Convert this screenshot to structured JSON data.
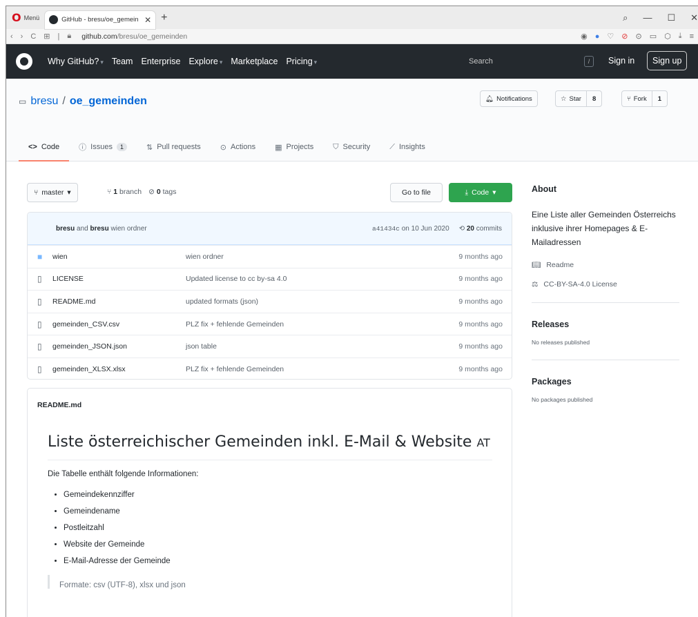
{
  "browser": {
    "menu_label": "Menü",
    "tab_title": "GitHub - bresu/oe_gemein",
    "url_host": "github.com",
    "url_path": "/bresu/oe_gemeinden"
  },
  "github_header": {
    "nav": [
      "Why GitHub?",
      "Team",
      "Enterprise",
      "Explore",
      "Marketplace",
      "Pricing"
    ],
    "search_placeholder": "Search",
    "slash_hint": "/",
    "sign_in": "Sign in",
    "sign_up": "Sign up"
  },
  "repo": {
    "owner": "bresu",
    "separator": "/",
    "name": "oe_gemeinden",
    "notifications_label": "Notifications",
    "star_label": "Star",
    "star_count": "8",
    "fork_label": "Fork",
    "fork_count": "1"
  },
  "tabs": [
    {
      "label": "Code"
    },
    {
      "label": "Issues",
      "badge": "1"
    },
    {
      "label": "Pull requests"
    },
    {
      "label": "Actions"
    },
    {
      "label": "Projects"
    },
    {
      "label": "Security"
    },
    {
      "label": "Insights"
    }
  ],
  "branch": {
    "name": "master",
    "branch_count": "1",
    "branch_label": "branch",
    "tag_count": "0",
    "tag_label": "tags",
    "go_to_file": "Go to file",
    "code_button": "Code"
  },
  "commit": {
    "author": "bresu",
    "and": "and",
    "coauthor": "bresu",
    "message": "wien ordner",
    "sha": "a41434c",
    "date": "on 10 Jun 2020",
    "commits_count": "20",
    "commits_label": "commits"
  },
  "files": [
    {
      "name": "wien",
      "message": "wien ordner",
      "age": "9 months ago",
      "type": "dir"
    },
    {
      "name": "LICENSE",
      "message": "Updated license to cc by-sa 4.0",
      "age": "9 months ago",
      "type": "file"
    },
    {
      "name": "README.md",
      "message": "updated formats (json)",
      "age": "9 months ago",
      "type": "file"
    },
    {
      "name": "gemeinden_CSV.csv",
      "message": "PLZ fix + fehlende Gemeinden",
      "age": "9 months ago",
      "type": "file"
    },
    {
      "name": "gemeinden_JSON.json",
      "message": "json table",
      "age": "9 months ago",
      "type": "file"
    },
    {
      "name": "gemeinden_XLSX.xlsx",
      "message": "PLZ fix + fehlende Gemeinden",
      "age": "9 months ago",
      "type": "file"
    }
  ],
  "readme": {
    "filename": "README.md",
    "heading": "Liste österreichischer Gemeinden inkl. E-Mail & Website",
    "heading_suffix": "AT",
    "intro": "Die Tabelle enthält folgende Informationen:",
    "items": [
      "Gemeindekennziffer",
      "Gemeindename",
      "Postleitzahl",
      "Website der Gemeinde",
      "E-Mail-Adresse der Gemeinde"
    ],
    "quote": "Formate: csv (UTF-8), xlsx und json"
  },
  "sidebar": {
    "about_title": "About",
    "description": "Eine Liste aller Gemeinden Österreichs inklusive ihrer Homepages & E-Mailadressen",
    "readme_link": "Readme",
    "license_link": "CC-BY-SA-4.0 License",
    "releases_title": "Releases",
    "releases_none": "No releases published",
    "packages_title": "Packages",
    "packages_none": "No packages published"
  },
  "colors": {
    "header_bg": "#24292e",
    "link": "#0366d6",
    "code_button": "#2ea44f",
    "active_tab_underline": "#f9826c",
    "opera_red": "#d60f1d"
  }
}
